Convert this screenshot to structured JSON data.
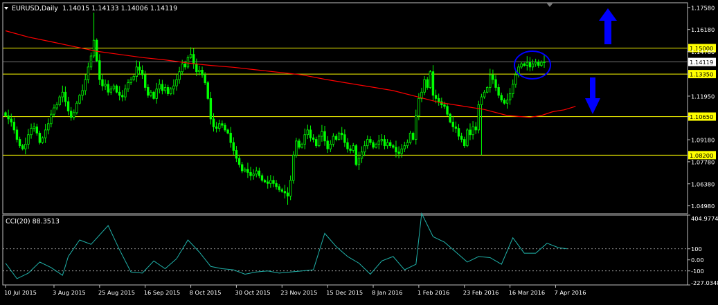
{
  "window": {
    "symbol_label": "EURUSD,Daily",
    "ohlc_label": "1.14015 1.14133 1.14006 1.14119",
    "sub_label": "CCI(20) 88.3513"
  },
  "colors": {
    "background": "#000000",
    "frame": "#c0c0c0",
    "text": "#ffffff",
    "candle": "#00ff00",
    "ma": "#ff0000",
    "levels": "#ffff00",
    "cci": "#20b2aa",
    "annotation": "#0000ff",
    "price_tag": "#ffff00",
    "current_tag": "#ffffff"
  },
  "chart_data": [
    {
      "type": "candlestick",
      "ylim": [
        1.0448,
        1.1788
      ],
      "ytick_labels": [
        "1.17580",
        "1.16180",
        "1.14780",
        "1.13350",
        "1.11950",
        "1.10650",
        "1.09180",
        "1.07780",
        "1.06380",
        "1.04980"
      ],
      "ytick_values": [
        1.1758,
        1.1618,
        1.1478,
        1.1335,
        1.1195,
        1.1065,
        1.0918,
        1.0778,
        1.0638,
        1.0498
      ],
      "xtick_labels": [
        "10 Jul 2015",
        "3 Aug 2015",
        "25 Aug 2015",
        "16 Sep 2015",
        "8 Oct 2015",
        "30 Oct 2015",
        "23 Nov 2015",
        "15 Dec 2015",
        "8 Jan 2016",
        "1 Feb 2016",
        "23 Feb 2016",
        "16 Mar 2016",
        "7 Apr 2016"
      ],
      "xtick_index": [
        0,
        17,
        33,
        49,
        65,
        81,
        97,
        113,
        129,
        145,
        161,
        177,
        193
      ],
      "levels": [
        {
          "label": "1.15000",
          "value": 1.15
        },
        {
          "label": "1.13350",
          "value": 1.1335
        },
        {
          "label": "1.10650",
          "value": 1.1065
        },
        {
          "label": "1.08200",
          "value": 1.082
        }
      ],
      "current_price": {
        "label": "1.14119",
        "value": 1.14119
      },
      "close": [
        1.107,
        1.105,
        1.103,
        1.098,
        1.092,
        1.088,
        1.086,
        1.089,
        1.095,
        1.099,
        1.1,
        1.096,
        1.09,
        1.093,
        1.098,
        1.102,
        1.108,
        1.112,
        1.114,
        1.119,
        1.122,
        1.116,
        1.11,
        1.106,
        1.109,
        1.115,
        1.12,
        1.123,
        1.13,
        1.138,
        1.145,
        1.155,
        1.142,
        1.13,
        1.126,
        1.127,
        1.122,
        1.124,
        1.126,
        1.122,
        1.12,
        1.119,
        1.124,
        1.128,
        1.13,
        1.132,
        1.138,
        1.136,
        1.133,
        1.125,
        1.12,
        1.122,
        1.118,
        1.124,
        1.127,
        1.123,
        1.125,
        1.121,
        1.124,
        1.126,
        1.13,
        1.135,
        1.14,
        1.138,
        1.144,
        1.146,
        1.14,
        1.135,
        1.136,
        1.133,
        1.128,
        1.118,
        1.105,
        1.1,
        1.099,
        1.102,
        1.101,
        1.098,
        1.096,
        1.09,
        1.085,
        1.08,
        1.076,
        1.072,
        1.073,
        1.071,
        1.069,
        1.07,
        1.072,
        1.069,
        1.066,
        1.065,
        1.064,
        1.066,
        1.064,
        1.062,
        1.06,
        1.059,
        1.058,
        1.056,
        1.066,
        1.082,
        1.091,
        1.087,
        1.089,
        1.095,
        1.098,
        1.093,
        1.092,
        1.088,
        1.094,
        1.097,
        1.091,
        1.086,
        1.089,
        1.094,
        1.092,
        1.096,
        1.095,
        1.09,
        1.086,
        1.085,
        1.088,
        1.076,
        1.08,
        1.084,
        1.088,
        1.092,
        1.09,
        1.087,
        1.089,
        1.091,
        1.092,
        1.088,
        1.09,
        1.088,
        1.087,
        1.084,
        1.083,
        1.086,
        1.088,
        1.09,
        1.096,
        1.092,
        1.107,
        1.118,
        1.122,
        1.13,
        1.125,
        1.135,
        1.12,
        1.118,
        1.116,
        1.114,
        1.113,
        1.108,
        1.103,
        1.1,
        1.099,
        1.094,
        1.092,
        1.088,
        1.098,
        1.095,
        1.1,
        1.098,
        1.114,
        1.119,
        1.122,
        1.125,
        1.133,
        1.13,
        1.125,
        1.12,
        1.117,
        1.115,
        1.117,
        1.121,
        1.127,
        1.133,
        1.138,
        1.14,
        1.139,
        1.141,
        1.138,
        1.14,
        1.141,
        1.139,
        1.141,
        1.1412
      ],
      "ma200": [
        1.161,
        1.157,
        1.154,
        1.151,
        1.148,
        1.146,
        1.144,
        1.1425,
        1.1405,
        1.139,
        1.1378,
        1.1362,
        1.1346,
        1.133,
        1.1302,
        1.1278,
        1.1254,
        1.123,
        1.1193,
        1.1156,
        1.1133,
        1.111,
        1.1072,
        1.106,
        1.1072,
        1.1096,
        1.1108,
        1.113
      ],
      "ma_index": [
        0,
        8,
        16,
        24,
        32,
        40,
        48,
        56,
        64,
        72,
        80,
        88,
        96,
        104,
        112,
        120,
        128,
        136,
        144,
        152,
        160,
        168,
        176,
        184,
        188,
        192,
        196,
        200
      ]
    },
    {
      "type": "line",
      "name": "CCI(20)",
      "ylim": [
        -227.0348,
        404.9774
      ],
      "ytick_labels": [
        "404.9774",
        "100",
        "0.00",
        "-100",
        "-227.0348"
      ],
      "ytick_values": [
        404.9774,
        100,
        0,
        -100,
        -227.0348
      ],
      "levels": [
        100,
        -100
      ],
      "index": [
        0,
        4,
        8,
        12,
        16,
        20,
        22,
        26,
        30,
        36,
        40,
        44,
        48,
        52,
        56,
        60,
        64,
        68,
        72,
        76,
        80,
        84,
        88,
        92,
        96,
        100,
        104,
        108,
        112,
        116,
        120,
        124,
        128,
        132,
        136,
        140,
        144,
        146,
        150,
        154,
        158,
        162,
        166,
        170,
        174,
        178,
        182,
        186,
        190,
        194,
        197
      ],
      "values": [
        -30,
        -170,
        -120,
        -20,
        -70,
        -140,
        30,
        180,
        140,
        310,
        90,
        -110,
        -120,
        -10,
        -80,
        10,
        180,
        70,
        -60,
        -80,
        -90,
        -130,
        -110,
        -100,
        -120,
        -110,
        -100,
        -90,
        240,
        120,
        30,
        -30,
        -130,
        -10,
        30,
        -90,
        -40,
        420,
        210,
        160,
        70,
        -20,
        30,
        20,
        -40,
        200,
        60,
        60,
        150,
        110,
        100
      ]
    }
  ],
  "annotations": {
    "up_arrow": "arrow-up",
    "down_arrow": "arrow-down",
    "circle": "ellipse"
  }
}
